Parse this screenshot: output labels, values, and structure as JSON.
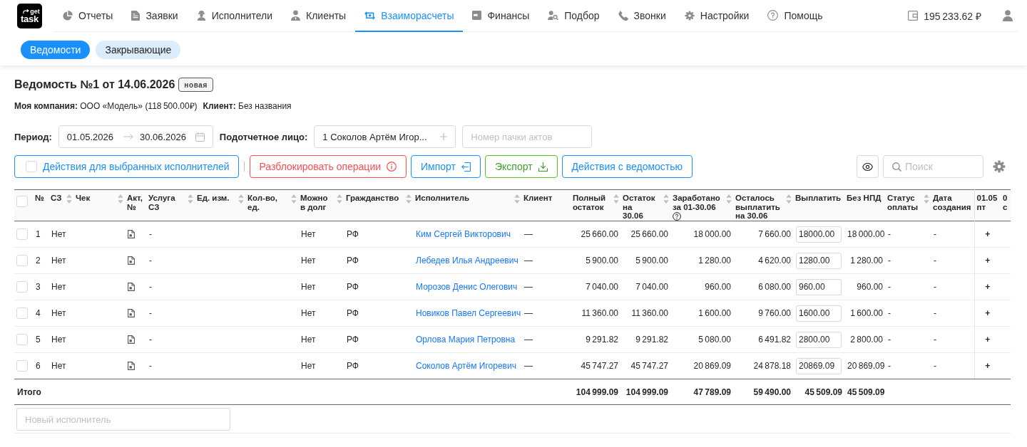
{
  "logo": {
    "top": "get",
    "bottom": "task"
  },
  "nav": [
    {
      "label": "Отчеты",
      "selected": false
    },
    {
      "label": "Заявки",
      "selected": false
    },
    {
      "label": "Исполнители",
      "selected": false
    },
    {
      "label": "Клиенты",
      "selected": false
    },
    {
      "label": "Взаиморасчеты",
      "selected": true
    },
    {
      "label": "Финансы",
      "selected": false
    },
    {
      "label": "Подбор",
      "selected": false
    },
    {
      "label": "Звонки",
      "selected": false
    },
    {
      "label": "Настройки",
      "selected": false
    },
    {
      "label": "Помощь",
      "selected": false
    }
  ],
  "balance": "195 233.62 ₽",
  "sub_tabs": [
    {
      "label": "Ведомости",
      "selected": true
    },
    {
      "label": "Закрывающие",
      "selected": false
    }
  ],
  "sheet": {
    "title": "Ведомость №1 от 14.06.2026",
    "status": "новая",
    "company": "**Моя компания:** ООО «Модель» (118 500.00₽)",
    "client": "**Клиент:** Без названия"
  },
  "filters": {
    "period_label": "Период:",
    "date_from": "01.05.2026",
    "date_to": "30.06.2026",
    "person_label": "Подотчетное лицо:",
    "person_value": "1 Соколов Артём Игор...",
    "act_number_placeholder": "Номер пачки актов"
  },
  "actions": {
    "bulk": {
      "label": "Действия для выбранных исполнителей",
      "checked": false
    },
    "buttons": [
      {
        "label": "Разблокировать операции",
        "kind": "danger"
      },
      {
        "label": "Импорт",
        "kind": "import"
      },
      {
        "label": "Экспорт",
        "kind": "export"
      },
      {
        "label": "Действия с ведомостью",
        "kind": "default"
      }
    ],
    "search_placeholder": "Поиск"
  },
  "table": {
    "select_all": {
      "checked": false
    },
    "columns": [
      {
        "label": "№",
        "sortable": false,
        "help": false
      },
      {
        "label": "СЗ",
        "sortable": true,
        "help": false
      },
      {
        "label": "Чек",
        "sortable": true,
        "help": false
      },
      {
        "label": "Акт,\n№",
        "sortable": false,
        "help": false
      },
      {
        "label": "Услуга\nСЗ",
        "sortable": true,
        "help": false
      },
      {
        "label": "Ед. изм.",
        "sortable": true,
        "help": false
      },
      {
        "label": "Кол-во,\nед.",
        "sortable": true,
        "help": false
      },
      {
        "label": "Можно\nв долг",
        "sortable": true,
        "help": false
      },
      {
        "label": "Гражданство",
        "sortable": true,
        "help": false
      },
      {
        "label": "Исполнитель",
        "sortable": true,
        "help": false
      },
      {
        "label": "Клиент",
        "sortable": false,
        "help": false
      },
      {
        "label": "Полный\nостаток",
        "sortable": true,
        "help": false
      },
      {
        "label": "Остаток\nна\n30.06",
        "sortable": true,
        "help": false
      },
      {
        "label": "Заработано\nза 01-30.06",
        "sortable": true,
        "help": true
      },
      {
        "label": "Осталось\nвыплатить\nна 30.06",
        "sortable": true,
        "help": false
      },
      {
        "label": "Выплатить",
        "sortable": false,
        "help": false
      },
      {
        "label": "Без НПД",
        "sortable": false,
        "help": false
      },
      {
        "label": "Статус\nоплаты",
        "sortable": true,
        "help": false
      },
      {
        "label": "Дата\nсоздания",
        "sortable": false,
        "help": false
      },
      {
        "label": "01.05\nпт",
        "sortable": false,
        "help": false
      },
      {
        "label": "0\nс",
        "sortable": false,
        "help": false
      }
    ],
    "rows": [
      {
        "checked": false,
        "number": "1",
        "self_employed": "Нет",
        "service": "-",
        "can_debt": "Нет",
        "citizenship": "РФ",
        "executor": "Ким Сергей Викторович",
        "client": "—",
        "full_balance": "25 660.00",
        "balance_on_date": "25 660.00",
        "earned": "18 000.00",
        "remaining": "7 660.00",
        "pay": "18000.00",
        "without_npd": "18 000.00",
        "payment_status": "-",
        "created": "-",
        "day_1": "+"
      },
      {
        "checked": false,
        "number": "2",
        "self_employed": "Нет",
        "service": "-",
        "can_debt": "Нет",
        "citizenship": "РФ",
        "executor": "Лебедев Илья Андреевич",
        "client": "—",
        "full_balance": "5 900.00",
        "balance_on_date": "5 900.00",
        "earned": "1 280.00",
        "remaining": "4 620.00",
        "pay": "1280.00",
        "without_npd": "1 280.00",
        "payment_status": "-",
        "created": "-",
        "day_1": "+"
      },
      {
        "checked": false,
        "number": "3",
        "self_employed": "Нет",
        "service": "-",
        "can_debt": "Нет",
        "citizenship": "РФ",
        "executor": "Морозов Денис Олегович",
        "client": "—",
        "full_balance": "7 040.00",
        "balance_on_date": "7 040.00",
        "earned": "960.00",
        "remaining": "6 080.00",
        "pay": "960.00",
        "without_npd": "960.00",
        "payment_status": "-",
        "created": "-",
        "day_1": "+"
      },
      {
        "checked": false,
        "number": "4",
        "self_employed": "Нет",
        "service": "-",
        "can_debt": "Нет",
        "citizenship": "РФ",
        "executor": "Новиков Павел Сергеевич",
        "client": "—",
        "full_balance": "11 360.00",
        "balance_on_date": "11 360.00",
        "earned": "1 600.00",
        "remaining": "9 760.00",
        "pay": "1600.00",
        "without_npd": "1 600.00",
        "payment_status": "-",
        "created": "-",
        "day_1": "+"
      },
      {
        "checked": false,
        "number": "5",
        "self_employed": "Нет",
        "service": "-",
        "can_debt": "Нет",
        "citizenship": "РФ",
        "executor": "Орлова Мария Петровна",
        "client": "—",
        "full_balance": "9 291.82",
        "balance_on_date": "9 291.82",
        "earned": "5 080.00",
        "remaining": "6 491.82",
        "pay": "2800.00",
        "without_npd": "2 800.00",
        "payment_status": "-",
        "created": "-",
        "day_1": "+"
      },
      {
        "checked": false,
        "number": "6",
        "self_employed": "Нет",
        "service": "-",
        "can_debt": "Нет",
        "citizenship": "РФ",
        "executor": "Соколов Артём Игоревич",
        "client": "—",
        "full_balance": "45 747.27",
        "balance_on_date": "45 747.27",
        "earned": "20 869.09",
        "remaining": "24 878.18",
        "pay": "20869.09",
        "without_npd": "20 869.09",
        "payment_status": "-",
        "created": "-",
        "day_1": "+"
      }
    ],
    "totals": {
      "label": "Итого",
      "full_balance": "104 999.09",
      "balance_on_date": "104 999.09",
      "earned": "47 789.09",
      "remaining": "59 490.00",
      "pay": "45 509.09",
      "without_npd": "45 509.09"
    },
    "new_row_placeholder": "Новый исполнитель"
  }
}
